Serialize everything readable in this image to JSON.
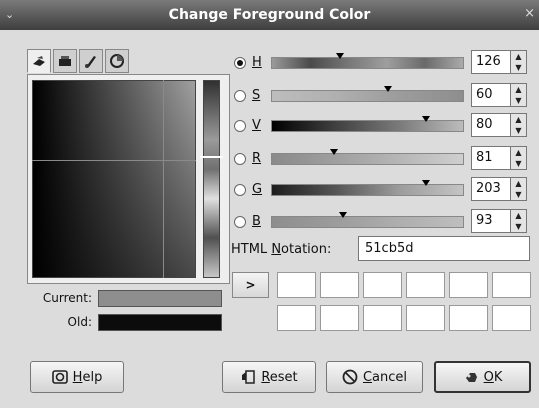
{
  "window": {
    "title": "Change Foreground Color",
    "menu_icon": "window-menu-icon",
    "close_glyph": "×"
  },
  "tabs": [
    {
      "name": "gimp-selector-icon",
      "active": true
    },
    {
      "name": "cmyk-selector-icon",
      "active": false
    },
    {
      "name": "watercolor-brush-icon",
      "active": false
    },
    {
      "name": "color-wheel-icon",
      "active": false
    }
  ],
  "current": {
    "label": "Current:",
    "color": "#8e8e8e"
  },
  "old": {
    "label": "Old:",
    "color": "#0c0c0c"
  },
  "channels": [
    {
      "key": "H",
      "value": "126",
      "selected": true,
      "marker_fraction": 0.35,
      "gradient": [
        "#9a9a9a",
        "#4a4a4a",
        "#777777",
        "#9e9e9e",
        "#6a6a6a",
        "#aaaaaa"
      ]
    },
    {
      "key": "S",
      "value": "60",
      "selected": false,
      "marker_fraction": 0.6,
      "gradient": [
        "#bdbdbd",
        "#b0b0b0",
        "#9c9c9c",
        "#8e8e8e"
      ]
    },
    {
      "key": "V",
      "value": "80",
      "selected": false,
      "marker_fraction": 0.8,
      "gradient": [
        "#000000",
        "#404040",
        "#7a7a7a",
        "#bcbcbc"
      ]
    },
    {
      "key": "R",
      "value": "81",
      "selected": false,
      "marker_fraction": 0.32,
      "gradient": [
        "#8a8a8a",
        "#aaaaaa",
        "#cfcfcf"
      ]
    },
    {
      "key": "G",
      "value": "203",
      "selected": false,
      "marker_fraction": 0.8,
      "gradient": [
        "#1e1e1e",
        "#555555",
        "#9c9c9c",
        "#c4c4c4"
      ]
    },
    {
      "key": "B",
      "value": "93",
      "selected": false,
      "marker_fraction": 0.37,
      "gradient": [
        "#8e8e8e",
        "#9c9c9c",
        "#aeaeae",
        "#bebebe"
      ]
    }
  ],
  "html": {
    "label_prefix": "HTML ",
    "label_mnemonic": "N",
    "label_rest": "otation:",
    "value": "51cb5d"
  },
  "history": {
    "button_label": ">"
  },
  "buttons": {
    "help": {
      "mnemonic": "H",
      "rest": "elp"
    },
    "reset": {
      "mnemonic": "R",
      "rest": "eset"
    },
    "cancel": {
      "mnemonic": "C",
      "rest": "ancel"
    },
    "ok": {
      "mnemonic": "O",
      "rest": "K"
    }
  }
}
